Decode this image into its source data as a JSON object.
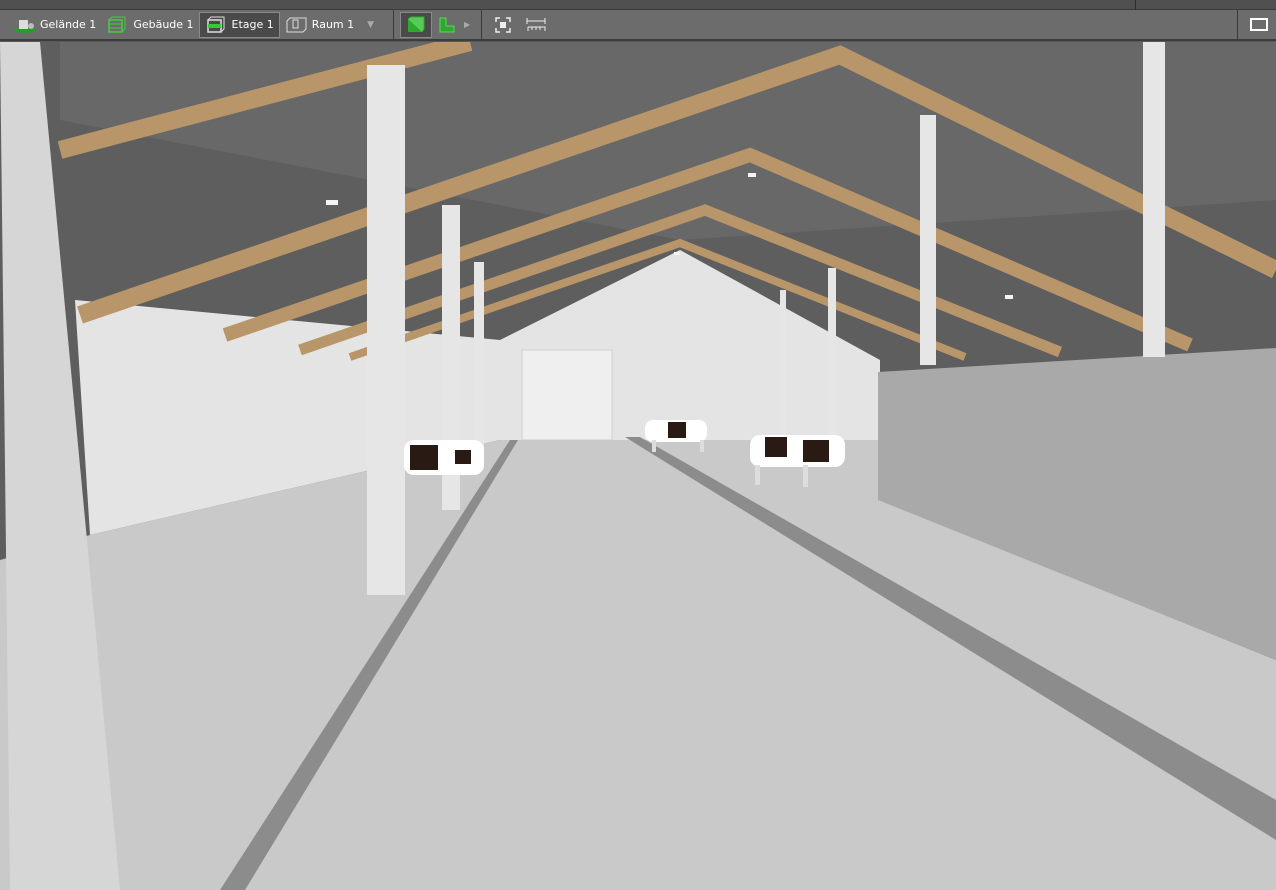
{
  "toolbar": {
    "items": [
      {
        "label": "Gelände 1",
        "icon": "terrain-icon"
      },
      {
        "label": "Gebäude 1",
        "icon": "building-icon"
      },
      {
        "label": "Etage 1",
        "icon": "floor-icon",
        "active": true
      },
      {
        "label": "Raum 1",
        "icon": "room-icon"
      }
    ],
    "tools": [
      "3d-view-icon",
      "floorplan-icon",
      "fit-view-icon",
      "measure-icon",
      "monitor-icon"
    ]
  },
  "colors": {
    "toolbar": "#6c6c6c",
    "accent_green": "#2fa82f",
    "rafter": "#b8966a"
  }
}
